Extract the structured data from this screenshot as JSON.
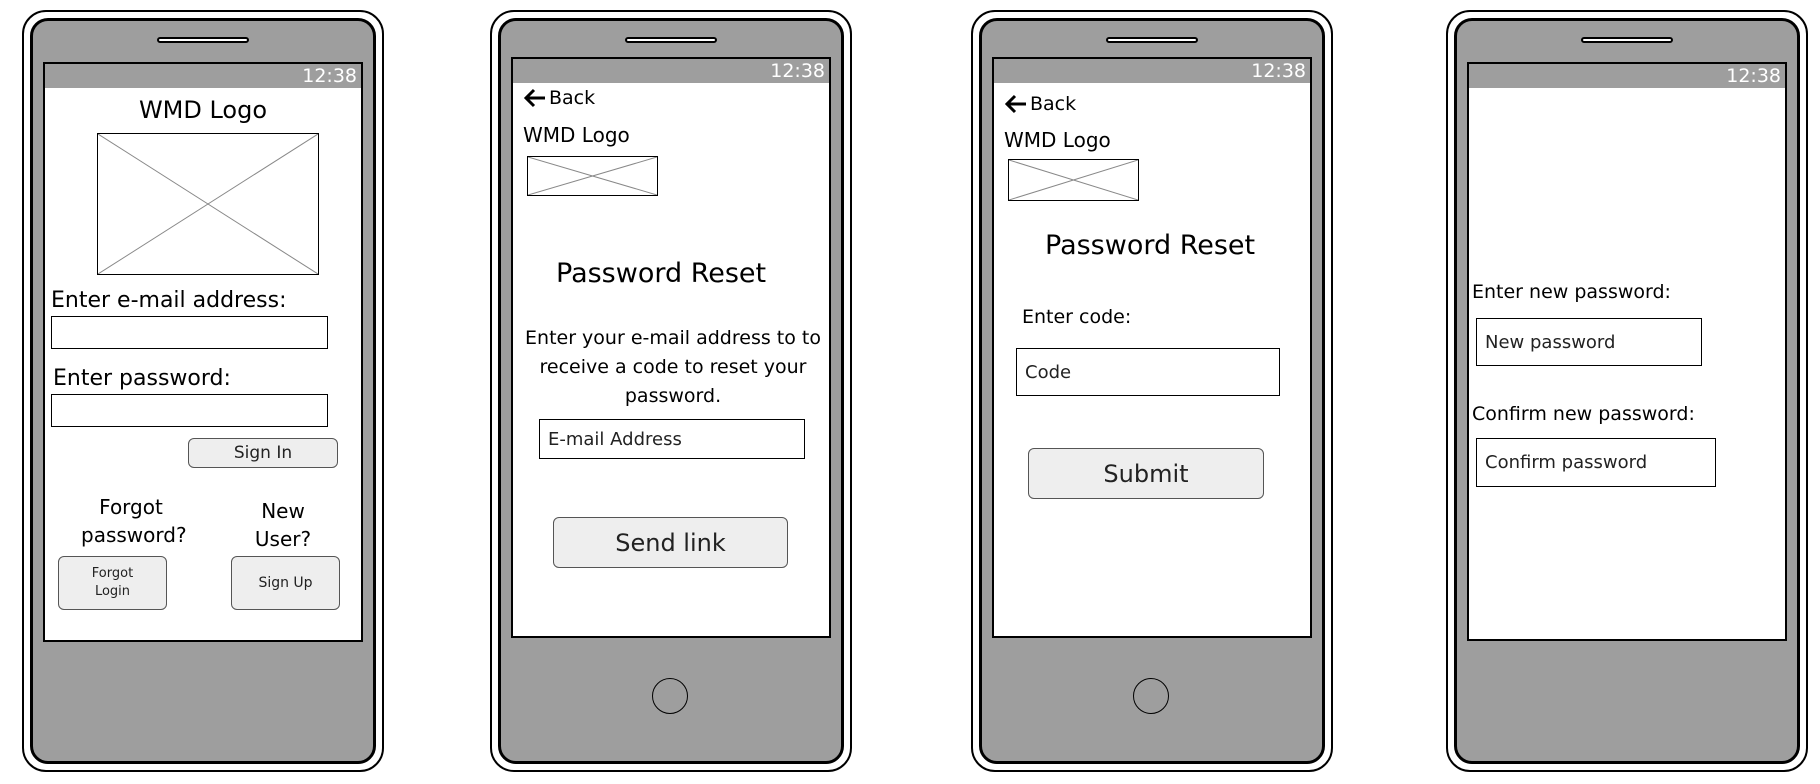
{
  "status_bar": {
    "time": "12:38"
  },
  "login": {
    "logo_label": "WMD Logo",
    "email_label": "Enter e-mail address:",
    "password_label": "Enter password:",
    "sign_in_button": "Sign In",
    "forgot_prompt": "Forgot password?",
    "new_user_prompt": "New User?",
    "forgot_login_button": "Forgot Login",
    "sign_up_button": "Sign Up"
  },
  "reset_email": {
    "back_label": "Back",
    "logo_label": "WMD Logo",
    "title": "Password Reset",
    "instructions": "Enter your e-mail address to to receive a code to reset your password.",
    "email_placeholder": "E-mail Address",
    "send_button": "Send link"
  },
  "reset_code": {
    "back_label": "Back",
    "logo_label": "WMD Logo",
    "title": "Password Reset",
    "code_label": "Enter code:",
    "code_placeholder": "Code",
    "submit_button": "Submit"
  },
  "new_password": {
    "new_label": "Enter new password:",
    "new_placeholder": "New password",
    "confirm_label": "Confirm new password:",
    "confirm_placeholder": "Confirm password"
  }
}
